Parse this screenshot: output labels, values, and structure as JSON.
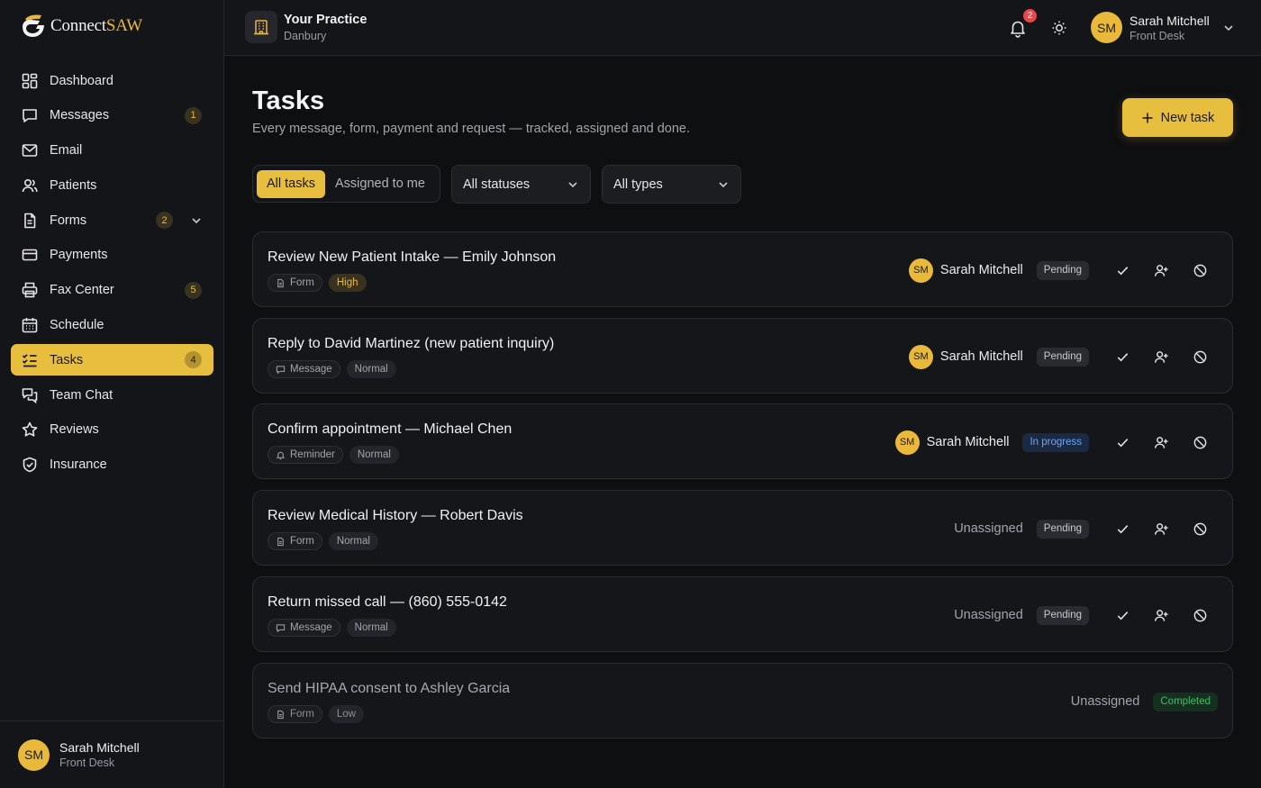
{
  "brand": {
    "name_main": "Connect",
    "name_accent": "SAW",
    "accent": "#e8be3e"
  },
  "sidebar": {
    "items": [
      {
        "label": "Dashboard",
        "icon": "dashboard-icon",
        "badge": ""
      },
      {
        "label": "Messages",
        "icon": "message-icon",
        "badge": "1"
      },
      {
        "label": "Email",
        "icon": "mail-icon",
        "badge": ""
      },
      {
        "label": "Patients",
        "icon": "users-icon",
        "badge": ""
      },
      {
        "label": "Forms",
        "icon": "document-icon",
        "badge": "2"
      },
      {
        "label": "Payments",
        "icon": "credit-card-icon",
        "badge": ""
      },
      {
        "label": "Fax Center",
        "icon": "printer-icon",
        "badge": "5"
      },
      {
        "label": "Schedule",
        "icon": "calendar-icon",
        "badge": ""
      },
      {
        "label": "Tasks",
        "icon": "task-list-icon",
        "badge": "4"
      },
      {
        "label": "Team Chat",
        "icon": "chat-icon",
        "badge": ""
      },
      {
        "label": "Reviews",
        "icon": "star-icon",
        "badge": ""
      },
      {
        "label": "Insurance",
        "icon": "shield-check-icon",
        "badge": ""
      }
    ],
    "active": "Tasks",
    "user": {
      "initials": "SM",
      "name": "Sarah Mitchell",
      "role": "Front Desk"
    }
  },
  "topbar": {
    "practice_name": "Your Practice",
    "practice_location": "Danbury",
    "notification_count": "2",
    "user": {
      "initials": "SM",
      "name": "Sarah Mitchell",
      "role": "Front Desk"
    }
  },
  "page": {
    "title": "Tasks",
    "subtitle": "Every message, form, payment and request — tracked, assigned and done.",
    "new_task_label": "New task"
  },
  "filters": {
    "segment_all": "All tasks",
    "segment_mine": "Assigned to me",
    "status_select": "All statuses",
    "type_select": "All types"
  },
  "tasks": [
    {
      "title": "Review New Patient Intake — Emily Johnson",
      "type": "Form",
      "priority": "High",
      "assignee": "Sarah Mitchell",
      "initials": "SM",
      "status": "Pending"
    },
    {
      "title": "Reply to David Martinez (new patient inquiry)",
      "type": "Message",
      "priority": "Normal",
      "assignee": "Sarah Mitchell",
      "initials": "SM",
      "status": "Pending"
    },
    {
      "title": "Confirm appointment — Michael Chen",
      "type": "Reminder",
      "priority": "Normal",
      "assignee": "Sarah Mitchell",
      "initials": "SM",
      "status": "In progress"
    },
    {
      "title": "Review Medical History — Robert Davis",
      "type": "Form",
      "priority": "Normal",
      "assignee": "Unassigned",
      "initials": "",
      "status": "Pending"
    },
    {
      "title": "Return missed call — (860) 555-0142",
      "type": "Message",
      "priority": "Normal",
      "assignee": "Unassigned",
      "initials": "",
      "status": "Pending"
    },
    {
      "title": "Send HIPAA consent to Ashley Garcia",
      "type": "Form",
      "priority": "Low",
      "assignee": "Unassigned",
      "initials": "",
      "status": "Completed"
    }
  ]
}
